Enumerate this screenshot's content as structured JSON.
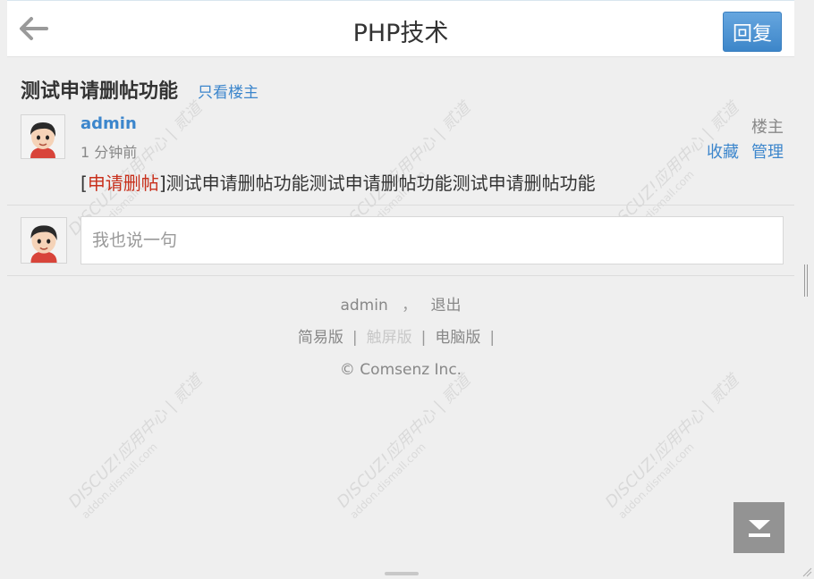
{
  "header": {
    "title": "PHP技术",
    "back_icon": "arrow-left-icon",
    "reply_label": "回复"
  },
  "thread": {
    "title": "测试申请删帖功能",
    "only_op_label": "只看楼主"
  },
  "post": {
    "author": "admin",
    "time": "1 分钟前",
    "floor_label": "楼主",
    "actions": [
      "收藏",
      "管理"
    ],
    "tag": "申请删帖",
    "body": "测试申请删帖功能测试申请删帖功能测试申请删帖功能"
  },
  "comment": {
    "placeholder": "我也说一句"
  },
  "footer": {
    "user": "admin",
    "user_sep": "，",
    "logout": "退出",
    "links": [
      "简易版",
      "触屏版",
      "电脑版"
    ],
    "copyright": "© Comsenz Inc."
  },
  "watermark": {
    "brand": "DISCUZ!应用中心 | 贰道",
    "site": "addon.dismall.com"
  },
  "colors": {
    "accent": "#3c86cc",
    "tag_red": "#c8301c",
    "reply_button": "#4a90d2"
  }
}
